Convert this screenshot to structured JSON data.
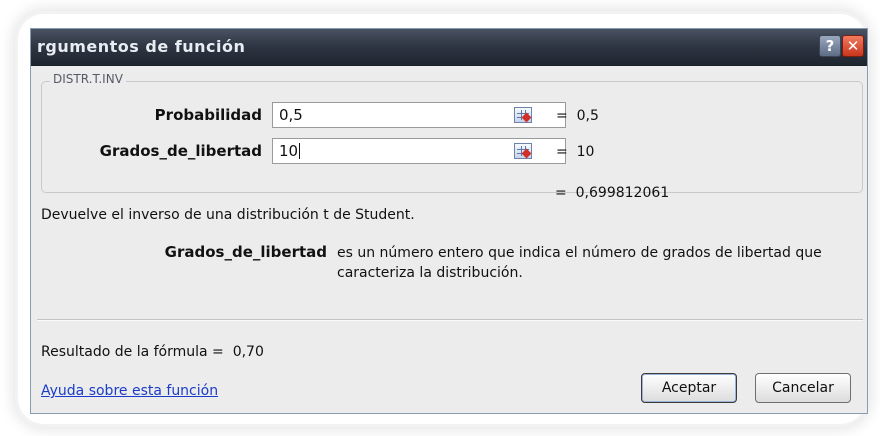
{
  "window": {
    "title": "rgumentos de función",
    "help_glyph": "?",
    "close_glyph": "✕"
  },
  "group": {
    "label": "DISTR.T.INV",
    "rows": [
      {
        "label": "Probabilidad",
        "value": "0,5",
        "equals": "=",
        "result": "0,5"
      },
      {
        "label": "Grados_de_libertad",
        "value": "10",
        "equals": "=",
        "result": "10"
      }
    ]
  },
  "function_result": {
    "equals": "=",
    "value": "0,699812061"
  },
  "description": "Devuelve el inverso de una distribución t de Student.",
  "argument_help": {
    "name": "Grados_de_libertad",
    "text": "es un número entero que indica el número de grados de libertad que caracteriza la distribución."
  },
  "formula_result": {
    "label": "Resultado de la fórmula =",
    "value": "0,70"
  },
  "help_link": "Ayuda sobre esta función",
  "buttons": {
    "ok": "Aceptar",
    "cancel": "Cancelar"
  },
  "icons": {
    "help": "help-icon",
    "close": "close-icon",
    "range_ref": "range-select-icon"
  }
}
